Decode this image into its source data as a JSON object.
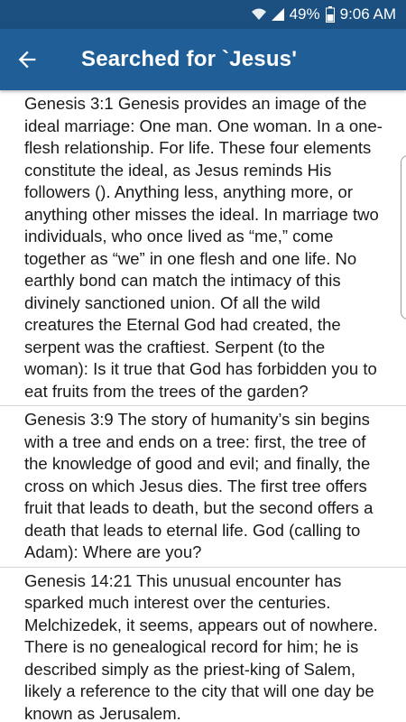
{
  "status_bar": {
    "battery_percent": "49%",
    "time": "9:06 AM"
  },
  "app_bar": {
    "title": "Searched for `Jesus'",
    "back_icon": "arrow-left-icon"
  },
  "results": [
    {
      "text": "Genesis 3:1 Genesis provides an image of the ideal marriage: One man. One woman. In a one-flesh relationship. For life. These four elements constitute the ideal, as Jesus reminds His followers (). Anything less, anything more, or anything other misses the ideal. In marriage two individuals, who once lived as “me,” come together as “we” in one flesh and one life. No earthly bond can match the intimacy of this divinely sanctioned union. Of all the wild creatures the Eternal God had created, the serpent was the craftiest. Serpent (to the woman): Is it true that God has forbidden you to eat fruits from the trees of the garden?"
    },
    {
      "text": "Genesis 3:9 The story of humanity’s sin begins with a tree and ends on a tree: first, the tree of the knowledge of good and evil; and finally, the cross on which Jesus dies. The first tree offers fruit that leads to death, but the second offers a death that leads to eternal life. God (calling to Adam): Where are you?"
    },
    {
      "text": "Genesis 14:21 This unusual encounter has sparked much interest over the centuries. Melchizedek, it seems, appears out of nowhere. There is no genealogical record for him; he is described simply as the priest-king of Salem, likely a reference to the city that will one day be known as Jerusalem."
    }
  ]
}
